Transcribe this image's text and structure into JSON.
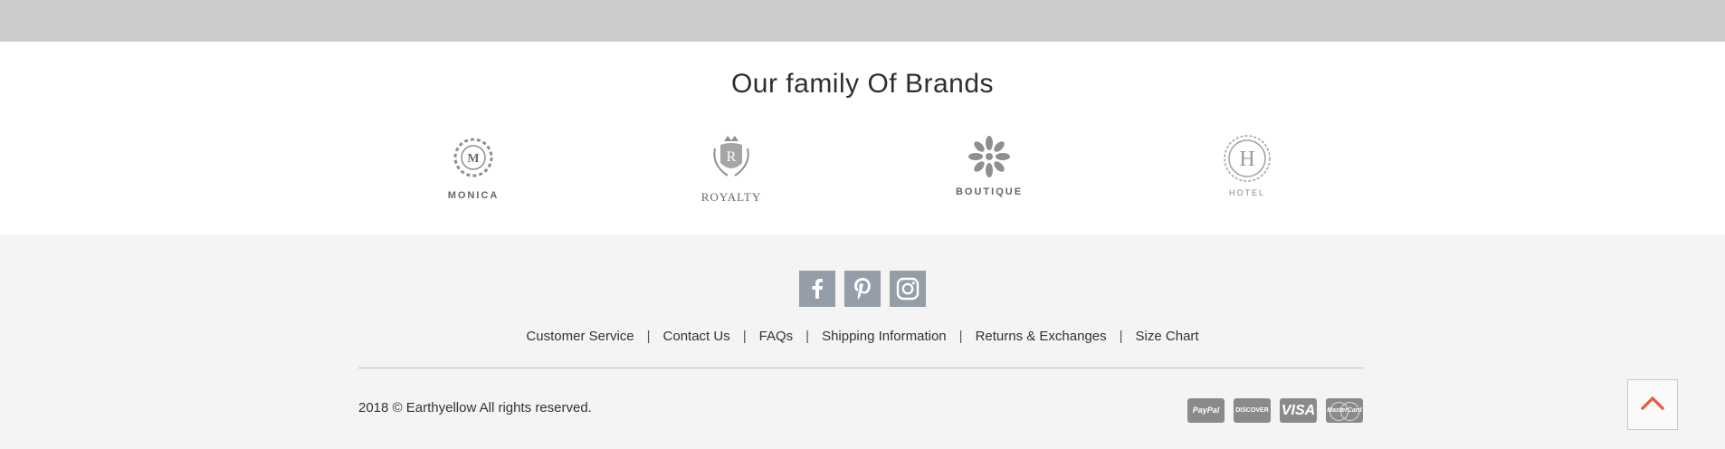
{
  "brands": {
    "title": "Our family Of Brands",
    "items": [
      {
        "name": "MONICA",
        "monogram": "M",
        "icon": "monica-logo-icon"
      },
      {
        "name": "ROYALTY",
        "monogram": "R",
        "icon": "royalty-crest-icon"
      },
      {
        "name": "BOUTIQUE",
        "monogram": "",
        "icon": "boutique-flower-icon"
      },
      {
        "name": "HOTEL",
        "monogram": "H",
        "icon": "hotel-logo-icon"
      }
    ]
  },
  "social": [
    {
      "name": "facebook",
      "icon": "facebook-icon"
    },
    {
      "name": "pinterest",
      "icon": "pinterest-icon"
    },
    {
      "name": "instagram",
      "icon": "instagram-icon"
    }
  ],
  "footer_links": [
    {
      "label": "Customer Service"
    },
    {
      "label": "Contact Us"
    },
    {
      "label": "FAQs"
    },
    {
      "label": "Shipping Information"
    },
    {
      "label": "Returns & Exchanges"
    },
    {
      "label": "Size Chart"
    }
  ],
  "separator": "|",
  "copyright": "2018 © Earthyellow All rights reserved.",
  "payments": [
    {
      "label": "PayPal",
      "icon": "paypal-icon"
    },
    {
      "label": "DISCOVER",
      "icon": "discover-icon"
    },
    {
      "label": "VISA",
      "icon": "visa-icon"
    },
    {
      "label": "MasterCard",
      "icon": "mastercard-icon"
    }
  ],
  "back_to_top": {
    "icon": "chevron-up-icon"
  },
  "colors": {
    "top_band": "#cbcbcb",
    "footer_bg": "#f4f4f4",
    "social_bg": "#959da8",
    "payment_bg": "#8a8a8a",
    "accent": "#e8593a"
  }
}
